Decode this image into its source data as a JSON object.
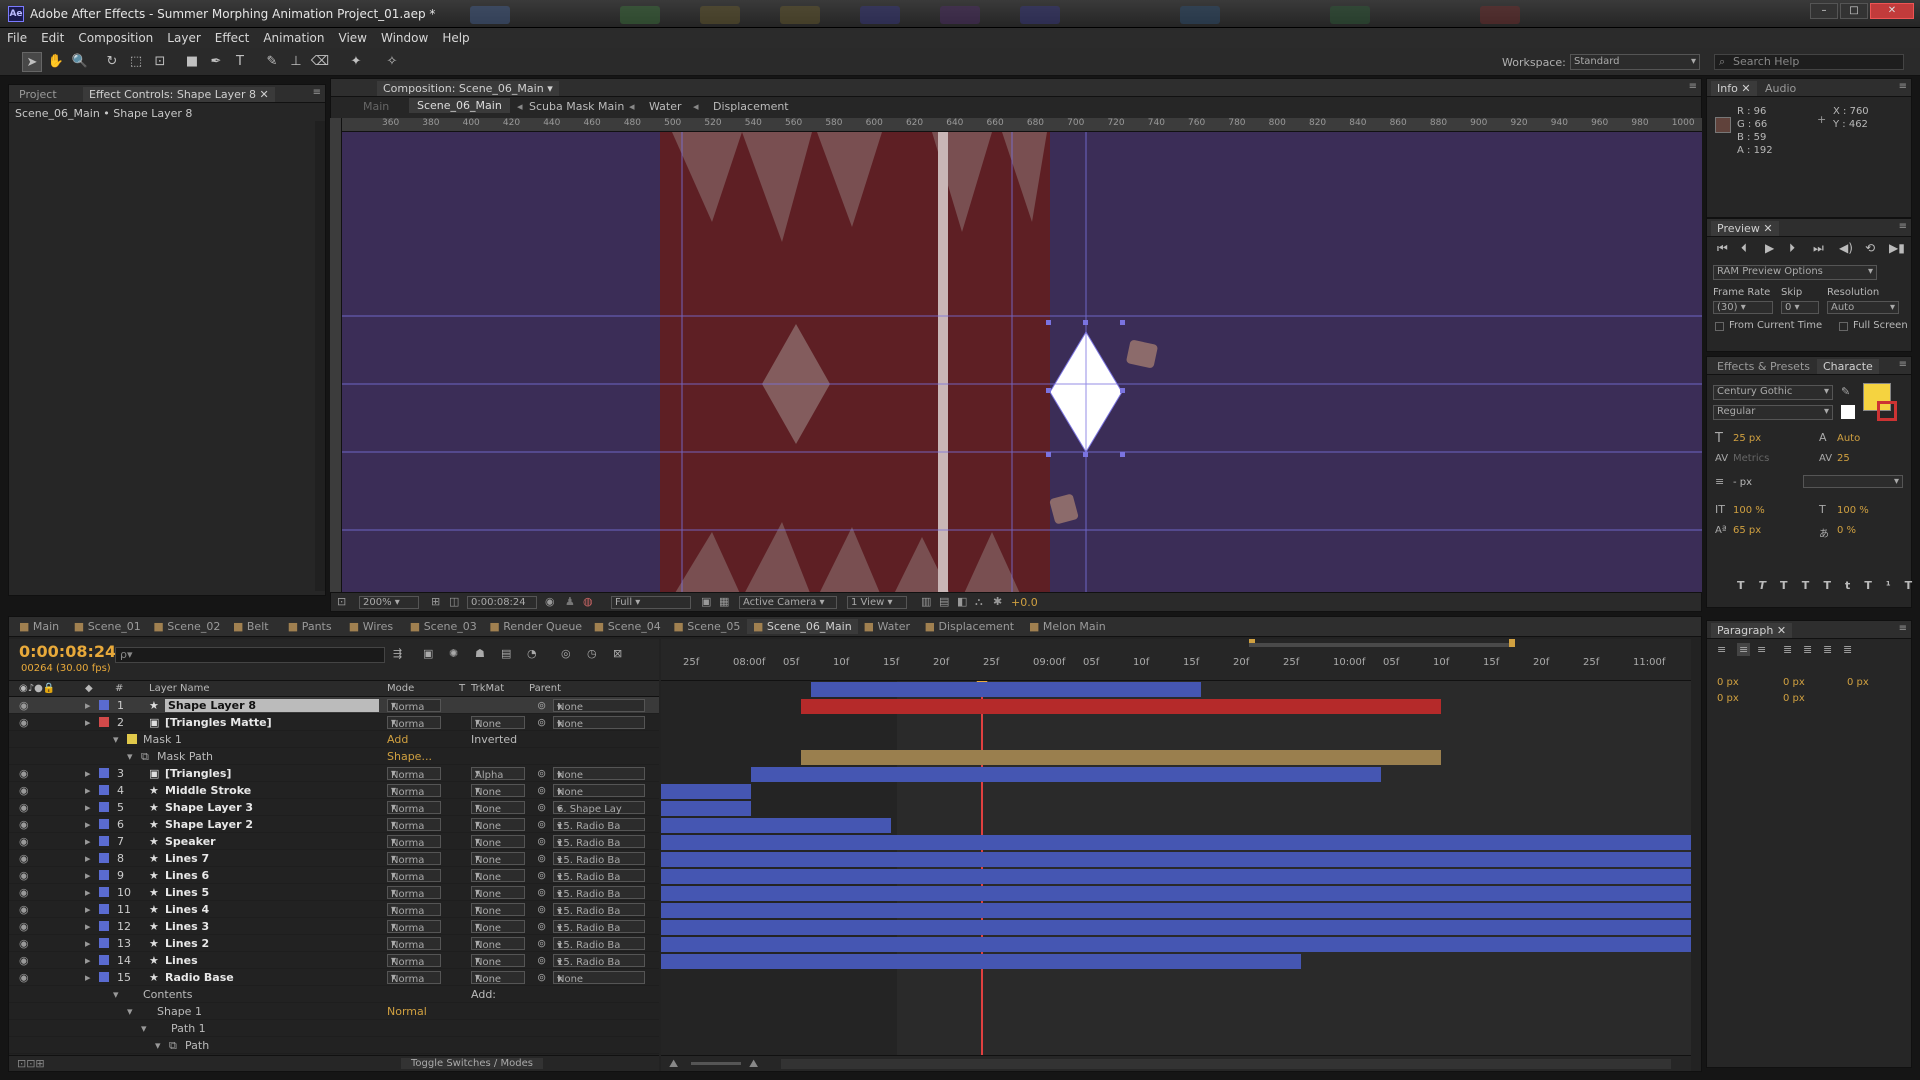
{
  "window": {
    "app_badge": "Ae",
    "title": "Adobe After Effects - Summer Morphing Animation Project_01.aep *",
    "controls": {
      "minimize": "–",
      "maximize": "□",
      "close": "✕"
    }
  },
  "menu": [
    "File",
    "Edit",
    "Composition",
    "Layer",
    "Effect",
    "Animation",
    "View",
    "Window",
    "Help"
  ],
  "toolbar": {
    "tools": [
      "selection-tool",
      "hand-tool",
      "zoom-tool",
      "rotate-tool",
      "camera-tool",
      "pan-behind-tool",
      "rectangle-tool",
      "pen-tool",
      "type-tool",
      "brush-tool",
      "clone-stamp-tool",
      "eraser-tool",
      "roto-brush-tool",
      "puppet-tool"
    ],
    "workspace_label": "Workspace:",
    "workspace_value": "Standard",
    "search_placeholder": "Search Help"
  },
  "left_panel": {
    "tabs": [
      "Project",
      "Effect Controls: Shape Layer 8"
    ],
    "breadcrumb": "Scene_06_Main • Shape Layer 8"
  },
  "composition": {
    "tab": "Composition: Scene_06_Main",
    "flow": [
      "Main",
      "Scene_06_Main",
      "Scuba Mask Main",
      "Water",
      "Displacement"
    ],
    "ruler_ticks": [
      "360",
      "380",
      "400",
      "420",
      "440",
      "460",
      "480",
      "500",
      "520",
      "540",
      "560",
      "580",
      "600",
      "620",
      "640",
      "660",
      "680",
      "700",
      "720",
      "740",
      "760",
      "780",
      "800",
      "820",
      "840",
      "860",
      "880",
      "900",
      "920",
      "940",
      "960",
      "980",
      "1000"
    ],
    "footer": {
      "zoom": "200%",
      "timecode": "0:00:08:24",
      "resolution": "Full",
      "camera": "Active Camera",
      "view": "1 View",
      "exposure": "+0.0"
    },
    "colors": {
      "bg": "#3b2d57",
      "board": "#5e1f24",
      "grid": "#7a73e0"
    }
  },
  "info_panel": {
    "tabs": [
      "Info",
      "Audio"
    ],
    "r": "R : 96",
    "g": "G : 66",
    "b": "B : 59",
    "a": "A : 192",
    "x": "X : 760",
    "y": "Y : 462"
  },
  "preview_panel": {
    "tab": "Preview",
    "ram_options": "RAM Preview Options",
    "frame_rate_label": "Frame Rate",
    "skip_label": "Skip",
    "resolution_label": "Resolution",
    "frame_rate": "(30)",
    "skip": "0",
    "resolution": "Auto",
    "from_current": "From Current Time",
    "full_screen": "Full Screen"
  },
  "character_panel": {
    "tabs": [
      "Effects & Presets",
      "Characte"
    ],
    "font": "Century Gothic",
    "style": "Regular",
    "size": "25 px",
    "leading": "Auto",
    "kerning": "Metrics",
    "tracking": "25",
    "stroke": "- px",
    "vscale": "100 %",
    "hscale": "100 %",
    "baseline": "65 px",
    "tsume": "0 %",
    "styles": [
      "T",
      "T",
      "TT",
      "Tt",
      "T¹",
      "T₁"
    ]
  },
  "paragraph_panel": {
    "tab": "Paragraph",
    "indent1": "0 px",
    "indent2": "0 px",
    "indent3": "0 px",
    "space1": "0 px",
    "space2": "0 px"
  },
  "timeline": {
    "tabs": [
      "Main",
      "Scene_01",
      "Scene_02",
      "Belt",
      "Pants",
      "Wires",
      "Scene_03",
      "Render Queue",
      "Scene_04",
      "Scene_05",
      "Scene_06_Main",
      "Water",
      "Displacement",
      "Melon Main"
    ],
    "active_tab": "Scene_06_Main",
    "timecode": "0:00:08:24",
    "frames": "00264 (30.00 fps)",
    "search_placeholder": "ρ▾",
    "col_headers": {
      "num": "#",
      "name": "Layer Name",
      "mode": "Mode",
      "t": "T",
      "trkmat": "TrkMat",
      "parent": "Parent"
    },
    "ruler": [
      "25f",
      "08:00f",
      "05f",
      "10f",
      "15f",
      "20f",
      "25f",
      "09:00f",
      "05f",
      "10f",
      "15f",
      "20f",
      "25f",
      "10:00f",
      "05f",
      "10f",
      "15f",
      "20f",
      "25f",
      "11:00f"
    ],
    "footer_label": "Toggle Switches / Modes",
    "rows": [
      {
        "num": "1",
        "icon": "★",
        "name": "Shape Layer 8",
        "mode": "Norma",
        "trk": "",
        "parent": "None",
        "color": "#5a6bd0",
        "sel": true
      },
      {
        "num": "2",
        "icon": "▣",
        "name": "[Triangles Matte]",
        "mode": "Norma",
        "trk": "None",
        "parent": "None",
        "color": "#d24a4a"
      },
      {
        "num": "",
        "icon": "",
        "name": "Mask 1",
        "mode": "Add",
        "trk": "Inverted",
        "parent": "",
        "color": "#e0c84a",
        "indent": 1
      },
      {
        "num": "",
        "icon": "⧉",
        "name": "Mask Path",
        "mode": "Shape...",
        "trk": "",
        "parent": "",
        "color": "",
        "indent": 2
      },
      {
        "num": "3",
        "icon": "▣",
        "name": "[Triangles]",
        "mode": "Norma",
        "trk": "Alpha",
        "parent": "None",
        "color": "#5a6bd0"
      },
      {
        "num": "4",
        "icon": "★",
        "name": "Middle Stroke",
        "mode": "Norma",
        "trk": "None",
        "parent": "None",
        "color": "#5a6bd0"
      },
      {
        "num": "5",
        "icon": "★",
        "name": "Shape Layer 3",
        "mode": "Norma",
        "trk": "None",
        "parent": "6. Shape Lay",
        "color": "#5a6bd0"
      },
      {
        "num": "6",
        "icon": "★",
        "name": "Shape Layer 2",
        "mode": "Norma",
        "trk": "None",
        "parent": "15. Radio Ba",
        "color": "#5a6bd0"
      },
      {
        "num": "7",
        "icon": "★",
        "name": "Speaker",
        "mode": "Norma",
        "trk": "None",
        "parent": "15. Radio Ba",
        "color": "#5a6bd0"
      },
      {
        "num": "8",
        "icon": "★",
        "name": "Lines 7",
        "mode": "Norma",
        "trk": "None",
        "parent": "15. Radio Ba",
        "color": "#5a6bd0"
      },
      {
        "num": "9",
        "icon": "★",
        "name": "Lines 6",
        "mode": "Norma",
        "trk": "None",
        "parent": "15. Radio Ba",
        "color": "#5a6bd0"
      },
      {
        "num": "10",
        "icon": "★",
        "name": "Lines 5",
        "mode": "Norma",
        "trk": "None",
        "parent": "15. Radio Ba",
        "color": "#5a6bd0"
      },
      {
        "num": "11",
        "icon": "★",
        "name": "Lines 4",
        "mode": "Norma",
        "trk": "None",
        "parent": "15. Radio Ba",
        "color": "#5a6bd0"
      },
      {
        "num": "12",
        "icon": "★",
        "name": "Lines 3",
        "mode": "Norma",
        "trk": "None",
        "parent": "15. Radio Ba",
        "color": "#5a6bd0"
      },
      {
        "num": "13",
        "icon": "★",
        "name": "Lines 2",
        "mode": "Norma",
        "trk": "None",
        "parent": "15. Radio Ba",
        "color": "#5a6bd0"
      },
      {
        "num": "14",
        "icon": "★",
        "name": "Lines",
        "mode": "Norma",
        "trk": "None",
        "parent": "15. Radio Ba",
        "color": "#5a6bd0"
      },
      {
        "num": "15",
        "icon": "★",
        "name": "Radio Base",
        "mode": "Norma",
        "trk": "None",
        "parent": "None",
        "color": "#5a6bd0"
      },
      {
        "num": "",
        "icon": "",
        "name": "Contents",
        "mode": "",
        "trk": "Add:",
        "parent": "",
        "color": "",
        "indent": 1
      },
      {
        "num": "",
        "icon": "",
        "name": "Shape 1",
        "mode": "Normal",
        "trk": "",
        "parent": "",
        "color": "",
        "indent": 2
      },
      {
        "num": "",
        "icon": "",
        "name": "Path 1",
        "mode": "",
        "trk": "",
        "parent": "",
        "color": "",
        "indent": 3
      },
      {
        "num": "",
        "icon": "⧉",
        "name": "Path",
        "mode": "",
        "trk": "",
        "parent": "",
        "color": "",
        "indent": 4
      }
    ]
  }
}
